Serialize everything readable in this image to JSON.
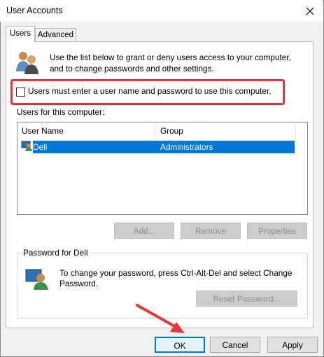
{
  "window": {
    "title": "User Accounts"
  },
  "tabs": [
    {
      "label": "Users"
    },
    {
      "label": "Advanced"
    }
  ],
  "intro_text": "Use the list below to grant or deny users access to your computer, and to change passwords and other settings.",
  "checkbox": {
    "label": "Users must enter a user name and password to use this computer.",
    "checked": false
  },
  "users_list": {
    "label": "Users for this computer:",
    "columns": [
      "User Name",
      "Group"
    ],
    "rows": [
      {
        "user": "Dell",
        "group": "Administrators",
        "selected": true
      }
    ]
  },
  "list_buttons": {
    "add": "Add...",
    "remove": "Remove",
    "properties": "Properties"
  },
  "password": {
    "group_label": "Password for Dell",
    "text": "To change your password, press Ctrl-Alt-Del and select Change Password.",
    "reset_button": "Reset Password..."
  },
  "footer_buttons": {
    "ok": "OK",
    "cancel": "Cancel",
    "apply": "Apply"
  },
  "colors": {
    "highlight": "#e0393e",
    "selection": "#0078d7",
    "annotation_arrow": "#e0393e"
  },
  "icons": [
    "close-icon",
    "users-icon",
    "user-row-icon",
    "password-user-icon"
  ]
}
